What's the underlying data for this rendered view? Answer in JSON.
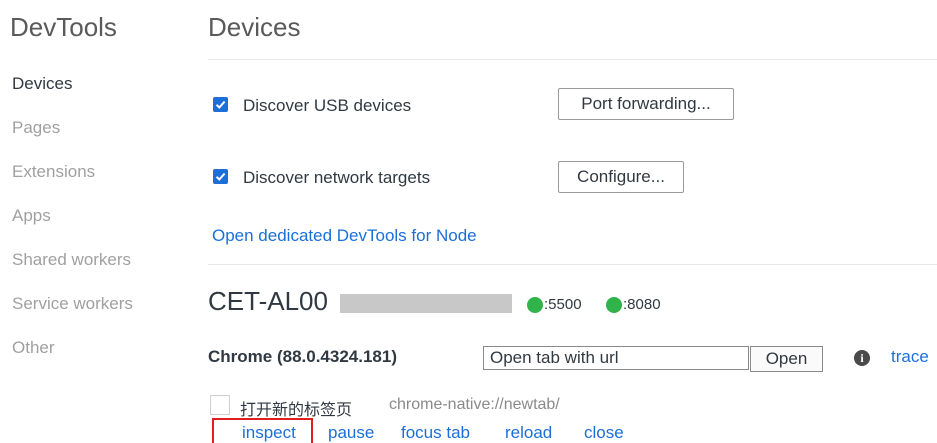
{
  "sidebar": {
    "title": "DevTools",
    "items": [
      {
        "label": "Devices"
      },
      {
        "label": "Pages"
      },
      {
        "label": "Extensions"
      },
      {
        "label": "Apps"
      },
      {
        "label": "Shared workers"
      },
      {
        "label": "Service workers"
      },
      {
        "label": "Other"
      }
    ]
  },
  "main": {
    "title": "Devices",
    "discover_usb": {
      "label": "Discover USB devices",
      "checked": true
    },
    "port_forwarding_button": "Port forwarding...",
    "discover_network": {
      "label": "Discover network targets",
      "checked": true
    },
    "configure_button": "Configure...",
    "node_link": "Open dedicated DevTools for Node"
  },
  "device": {
    "name": "CET-AL00",
    "ports": [
      ":5500",
      ":8080"
    ],
    "browser": "Chrome (88.0.4324.181)",
    "url_placeholder": "Open tab with url",
    "open_button": "Open",
    "trace_link": "trace",
    "tab": {
      "title": "打开新的标签页",
      "url": "chrome-native://newtab/",
      "actions": [
        "inspect",
        "pause",
        "focus tab",
        "reload",
        "close"
      ]
    }
  },
  "colors": {
    "accent": "#1a6fd8",
    "port_status": "#2fb34a",
    "highlight": "#e02020"
  }
}
